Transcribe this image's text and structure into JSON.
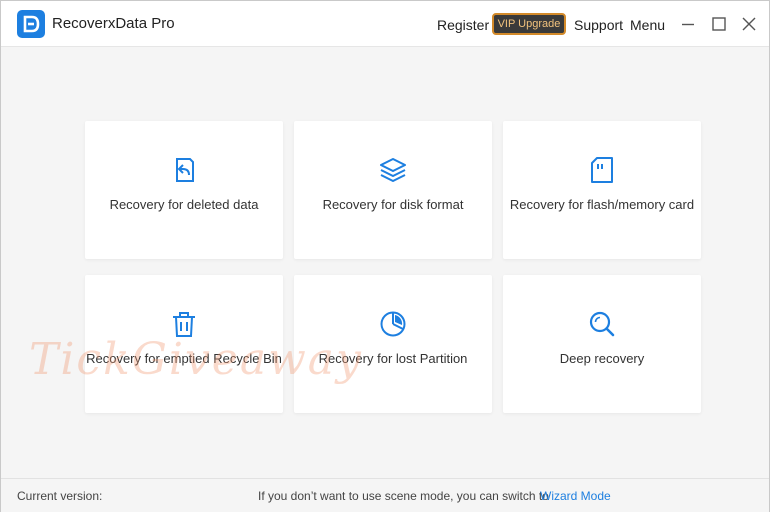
{
  "app": {
    "title": "RecoverxData Pro",
    "accent_color": "#1d7fe0"
  },
  "topbar": {
    "register_label": "Register",
    "vip_label": "VIP Upgrade",
    "support_label": "Support",
    "menu_label": "Menu"
  },
  "cards": [
    {
      "label": "Recovery for deleted data",
      "icon": "restore-file-icon"
    },
    {
      "label": "Recovery for disk format",
      "icon": "layers-icon"
    },
    {
      "label": "Recovery for flash/memory card",
      "icon": "memory-card-icon"
    },
    {
      "label": "Recovery for emptied Recycle Bin",
      "icon": "trash-icon"
    },
    {
      "label": "Recovery for lost Partition",
      "icon": "pie-chart-icon"
    },
    {
      "label": "Deep recovery",
      "icon": "search-icon"
    }
  ],
  "watermark": "TickGiveaway",
  "footer": {
    "version_label": "Current version:",
    "hint": "If you don’t want to use scene mode, you can switch to",
    "wizard_label": "Wizard Mode"
  }
}
